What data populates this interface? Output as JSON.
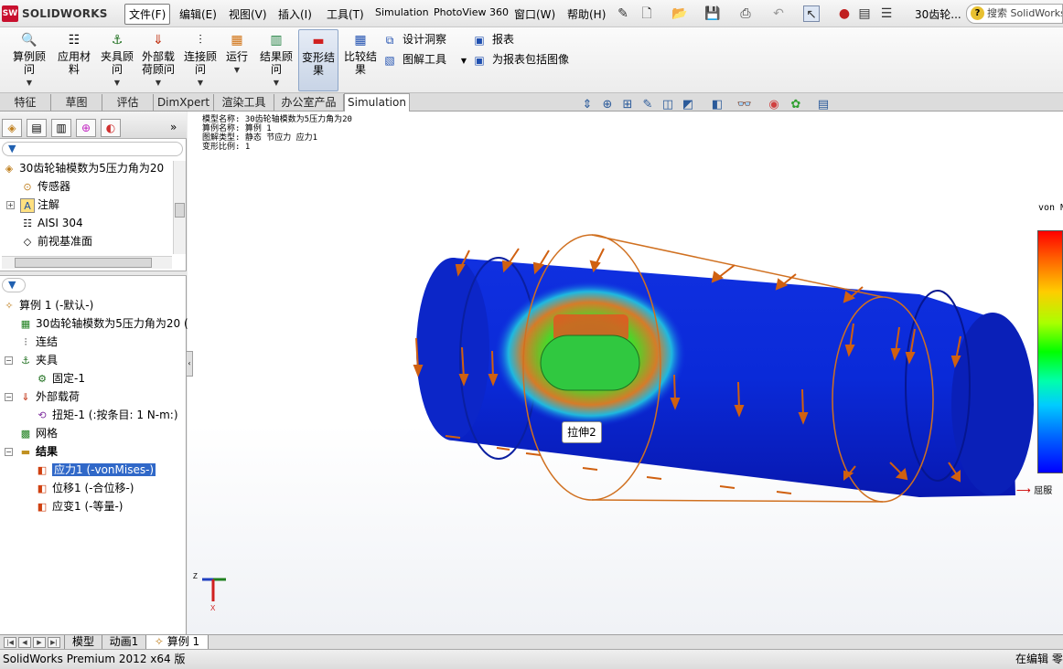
{
  "app": {
    "logo_text": "SOLIDWORKS",
    "logo_badge": "SW",
    "document_title": "30齿轮..."
  },
  "menu": [
    "文件(F)",
    "编辑(E)",
    "视图(V)",
    "插入(I)",
    "工具(T)",
    "Simulation",
    "PhotoView 360",
    "窗口(W)",
    "帮助(H)"
  ],
  "search": {
    "placeholder": "搜索 SolidWorks"
  },
  "ribbon": {
    "buttons": [
      {
        "label": "算例顾\n问",
        "icon": "study-advisor-icon"
      },
      {
        "label": "应用材\n料",
        "icon": "apply-material-icon"
      },
      {
        "label": "夹具顾\n问",
        "icon": "fixtures-advisor-icon"
      },
      {
        "label": "外部载\n荷顾问",
        "icon": "external-loads-advisor-icon"
      },
      {
        "label": "连接顾\n问",
        "icon": "connections-advisor-icon"
      },
      {
        "label": "运行",
        "icon": "run-icon"
      },
      {
        "label": "结果顾\n问",
        "icon": "results-advisor-icon"
      },
      {
        "label": "变形结\n果",
        "icon": "deformed-result-icon"
      },
      {
        "label": "比较结\n果",
        "icon": "compare-results-icon"
      }
    ],
    "small": [
      {
        "label": "设计洞察",
        "icon": "design-insight-icon"
      },
      {
        "label": "图解工具",
        "icon": "plot-tools-icon"
      },
      {
        "label": "报表",
        "icon": "report-icon"
      },
      {
        "label": "为报表包括图像",
        "icon": "include-image-icon"
      }
    ]
  },
  "tabs": [
    "特征",
    "草图",
    "评估",
    "DimXpert",
    "渲染工具",
    "办公室产品",
    "Simulation"
  ],
  "feature_tree": {
    "items": [
      {
        "label": "30齿轮轴模数为5压力角为20"
      },
      {
        "label": "传感器"
      },
      {
        "label": "注解"
      },
      {
        "label": "AISI 304"
      },
      {
        "label": "前视基准面"
      }
    ]
  },
  "study_tree": {
    "items": [
      {
        "label": "算例 1 (-默认-)"
      },
      {
        "label": "30齿轮轴模数为5压力角为20 ("
      },
      {
        "label": "连结"
      },
      {
        "label": "夹具"
      },
      {
        "label": "固定-1"
      },
      {
        "label": "外部载荷"
      },
      {
        "label": "扭矩-1 (:按条目: 1 N-m:)"
      },
      {
        "label": "网格"
      },
      {
        "label": "结果"
      },
      {
        "label": "应力1 (-vonMises-)"
      },
      {
        "label": "位移1 (-合位移-)"
      },
      {
        "label": "应变1 (-等量-)"
      }
    ]
  },
  "viewport": {
    "info": [
      "模型名称: 30齿轮轴模数为5压力角为20",
      "算例名称: 算例 1",
      "图解类型: 静态 节应力 应力1",
      "变形比例: 1"
    ],
    "legend_title": "von M",
    "legend_label": "屈服",
    "tooltip": "拉伸2",
    "triad": {
      "z": "Z",
      "x": "X"
    }
  },
  "bottom_tabs": [
    "模型",
    "动画1",
    "算例 1"
  ],
  "status": {
    "left": "SolidWorks Premium 2012 x64 版",
    "right": "在编辑 零"
  }
}
